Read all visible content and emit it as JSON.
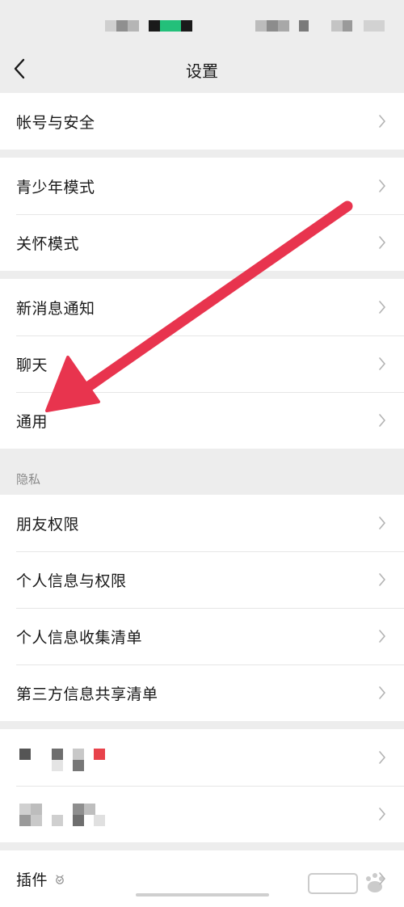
{
  "nav": {
    "title": "设置"
  },
  "groups": [
    {
      "items": [
        "帐号与安全"
      ]
    },
    {
      "items": [
        "青少年模式",
        "关怀模式"
      ]
    },
    {
      "items": [
        "新消息通知",
        "聊天",
        "通用"
      ]
    },
    {
      "header": "隐私",
      "items": [
        "朋友权限",
        "个人信息与权限",
        "个人信息收集清单",
        "第三方信息共享清单"
      ]
    },
    {
      "items": [
        "",
        ""
      ]
    },
    {
      "items": [
        "插件"
      ]
    }
  ],
  "icons": {
    "back": "chevron-left-icon",
    "row_arrow": "chevron-right-icon",
    "plugin_badge": "plugin-badge-icon"
  },
  "colors": {
    "background": "#ededed",
    "card": "#ffffff",
    "annotation_arrow": "#e8344e",
    "status_green": "#23c07a"
  }
}
